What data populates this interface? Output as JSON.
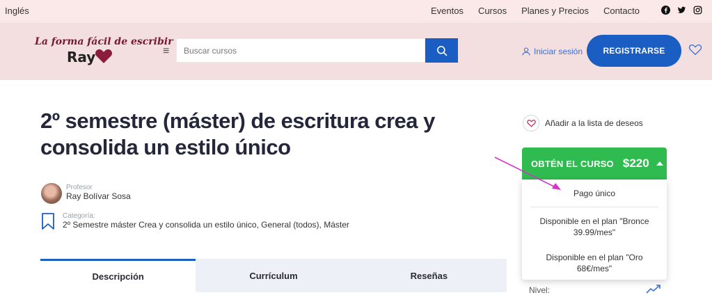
{
  "topbar": {
    "language": "Inglés",
    "nav": [
      "Eventos",
      "Cursos",
      "Planes y Precios",
      "Contacto"
    ],
    "social_icons": [
      "facebook-icon",
      "twitter-icon",
      "instagram-icon"
    ]
  },
  "header": {
    "logo_script": "La forma fácil de escribir",
    "logo_name": "Ray",
    "search_placeholder": "Buscar cursos",
    "login": "Iniciar sesión",
    "register": "REGISTRARSE"
  },
  "course": {
    "title": "2º semestre (máster) de escritura crea y consolida un estilo único",
    "teacher_label": "Profesor",
    "teacher_name": "Ray Bolívar Sosa",
    "category_label": "Categoría:",
    "category_value": "2º Semestre máster Crea y consolida un estilo único, General (todos), Máster"
  },
  "tabs": [
    "Descripción",
    "Currículum",
    "Reseñas"
  ],
  "sidebar": {
    "wishlist": "Añadir a la lista de deseos",
    "buy_label": "OBTÉN EL CURSO",
    "price": "$220",
    "options": [
      "Pago único",
      "Disponible en el plan  \"Bronce 39.99/mes\"",
      "Disponible en el plan  \"Oro 68€/mes\""
    ],
    "level_label": "Nivel:"
  },
  "colors": {
    "primary": "#1a5ec4",
    "buy_green": "#2fbb4f",
    "header_bg": "#f3dfdf",
    "annotation_arrow": "#d633c9"
  }
}
